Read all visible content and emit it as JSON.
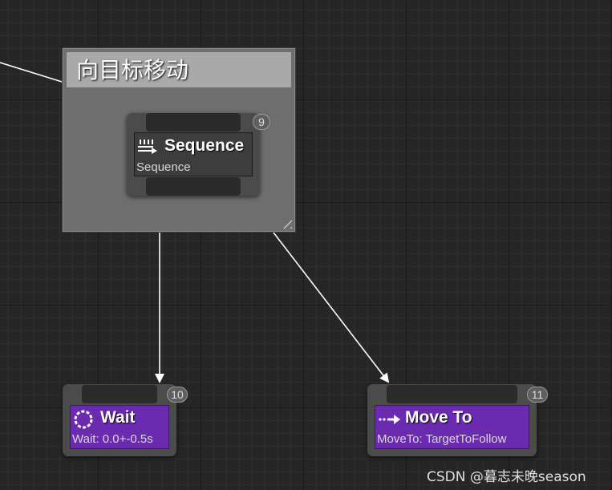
{
  "comment": {
    "title": "向目标移动"
  },
  "nodes": {
    "sequence": {
      "title": "Sequence",
      "subtitle": "Sequence",
      "index": "9",
      "icon": "sequence-icon"
    },
    "wait": {
      "title": "Wait",
      "subtitle": "Wait: 0.0+-0.5s",
      "index": "10",
      "icon": "wait-icon"
    },
    "moveto": {
      "title": "Move To",
      "subtitle": "MoveTo: TargetToFollow",
      "index": "11",
      "icon": "move-to-icon"
    }
  },
  "colors": {
    "canvas": "#262626",
    "comment_box": "#6e6e6e",
    "comment_title_bar": "#a9a9a9",
    "composite_node": "#3d3d3d",
    "task_node": "#6a2bb0",
    "wire": "#ffffff"
  },
  "watermark": "CSDN @暮志未晚season"
}
